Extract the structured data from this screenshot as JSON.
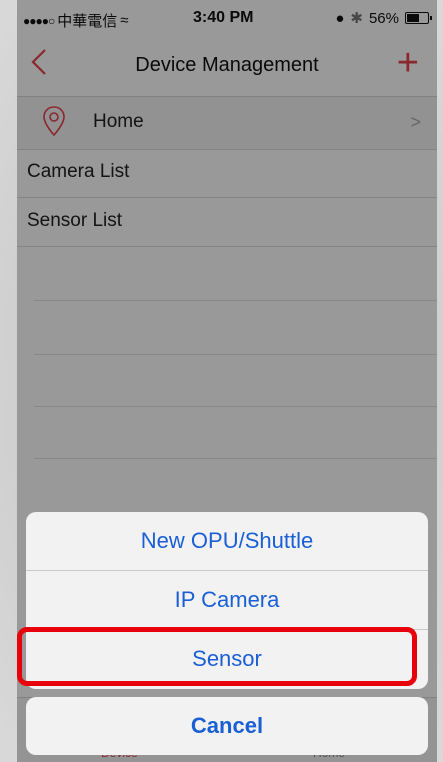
{
  "statusbar": {
    "signal": "●●●●○",
    "carrier": "中華電信",
    "wifi": "≈",
    "time": "3:40 PM",
    "alarm": "●",
    "bluetooth": "✱",
    "battery_percent": "56%"
  },
  "navbar": {
    "back_icon": "chevron-left",
    "title": "Device Management",
    "add_icon": "+"
  },
  "rows": {
    "home": {
      "label": "Home",
      "chevron": ">"
    },
    "camera_list": "Camera List",
    "sensor_list": "Sensor List"
  },
  "tabs": {
    "device": "Device",
    "home": "Home"
  },
  "action_sheet": {
    "options": [
      {
        "label": "New OPU/Shuttle"
      },
      {
        "label": "IP Camera"
      },
      {
        "label": "Sensor"
      }
    ],
    "cancel": "Cancel"
  },
  "colors": {
    "accent": "#e8414f",
    "action_blue": "#1a5fd6",
    "highlight_red": "#e8000b"
  }
}
